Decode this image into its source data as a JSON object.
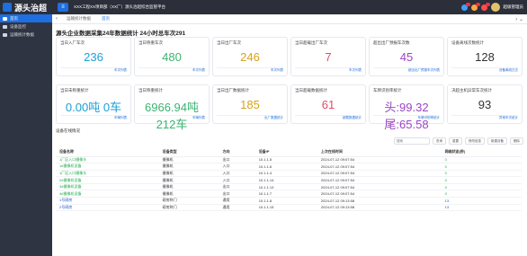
{
  "app": {
    "title": "源头治超",
    "top_title": "XXX工程XX项目部（XX厂）源头治超综合监管平台",
    "user_name": "超级管理员"
  },
  "sidebar": {
    "items": [
      {
        "label": "首页"
      },
      {
        "label": "设备监控"
      },
      {
        "label": "运输统计数据"
      }
    ]
  },
  "tabs": [
    {
      "label": "运输统计数据"
    },
    {
      "label": "首页"
    }
  ],
  "main": {
    "title": "源头企业数据采集24年数据统计 24小时总车次291",
    "cards": [
      {
        "label": "当日入厂车次",
        "value": "236",
        "link": "车次列表",
        "color": "#1c9fd6"
      },
      {
        "label": "当日称重车次",
        "value": "480",
        "link": "车次列表",
        "color": "#3cb371"
      },
      {
        "label": "当日出厂车次",
        "value": "246",
        "link": "车次列表",
        "color": "#d8a21a"
      },
      {
        "label": "当日超载出厂车次",
        "value": "7",
        "link": "车次列表",
        "color": "#e34b6b"
      },
      {
        "label": "超出出厂预报车次数",
        "value": "45",
        "link": "超出出厂预报车次列表",
        "color": "#9a45c6"
      },
      {
        "label": "设备离线次数统计",
        "value": "128",
        "link": "设备离线日志",
        "color": "#333333"
      },
      {
        "label": "当日未称重统计",
        "value": "0.00吨 0车",
        "link": "车辆列表",
        "color": "#1c9fd6"
      },
      {
        "label": "当日称重统计",
        "value": "6966.94吨 212车",
        "link": "车辆列表",
        "color": "#3cb371"
      },
      {
        "label": "当日出厂数据统计",
        "value": "185",
        "link": "出厂数据统计",
        "color": "#d8a21a"
      },
      {
        "label": "当日超载数据统计",
        "value": "61",
        "link": "超载数据统计",
        "color": "#e34b6b"
      },
      {
        "label": "车牌识别率统计",
        "value": "头:99.32 尾:65.58",
        "link": "车牌识别率统计",
        "color": "#9a45c6"
      },
      {
        "label": "决超主机异常车次统计",
        "value": "93",
        "link": "异常车次统计",
        "color": "#333333"
      }
    ]
  },
  "device": {
    "title": "设备在线情况",
    "search_placeholder": "搜索",
    "buttons": [
      "查询",
      "重置",
      "修改信息",
      "新建设备",
      "删除"
    ],
    "columns": [
      "设备名称",
      "设备类型",
      "方向",
      "设备IP",
      "上次在线时间",
      "网络状态(秒)"
    ],
    "rows": [
      {
        "name": "1厂区入口摄像头",
        "type": "摄像机",
        "dir": "出口",
        "ip": "10.1.1.5",
        "time": "2024-07-12 09:07:54",
        "status": "0"
      },
      {
        "name": "1#摄像机设备",
        "type": "摄像机",
        "dir": "入口",
        "ip": "10.1.1.6",
        "time": "2024-07-12 09:07:54",
        "status": "0"
      },
      {
        "name": "1厂区入口摄像头",
        "type": "摄像机",
        "dir": "入口",
        "ip": "10.1.1.4",
        "time": "2024-07-12 09:07:54",
        "status": "0"
      },
      {
        "name": "2#摄像机设备",
        "type": "摄像机",
        "dir": "入口",
        "ip": "10.1.1.14",
        "time": "2024-07-12 09:07:54",
        "status": "0"
      },
      {
        "name": "3#摄像机设备",
        "type": "摄像机",
        "dir": "出口",
        "ip": "10.1.1.13",
        "time": "2024-07-12 09:07:54",
        "status": "0"
      },
      {
        "name": "4#摄像机设备",
        "type": "摄像机",
        "dir": "出口",
        "ip": "10.1.1.7",
        "time": "2024-07-12 09:07:54",
        "status": "0"
      },
      {
        "name": "1号磅房",
        "type": "磅房称门",
        "dir": "通用",
        "ip": "10.1.1.8",
        "time": "2024-07-12 09:13:58",
        "status": "13"
      },
      {
        "name": "2号磅房",
        "type": "磅房称门",
        "dir": "通用",
        "ip": "10.1.1.15",
        "time": "2024-07-12 09:13:58",
        "status": "13"
      }
    ]
  }
}
